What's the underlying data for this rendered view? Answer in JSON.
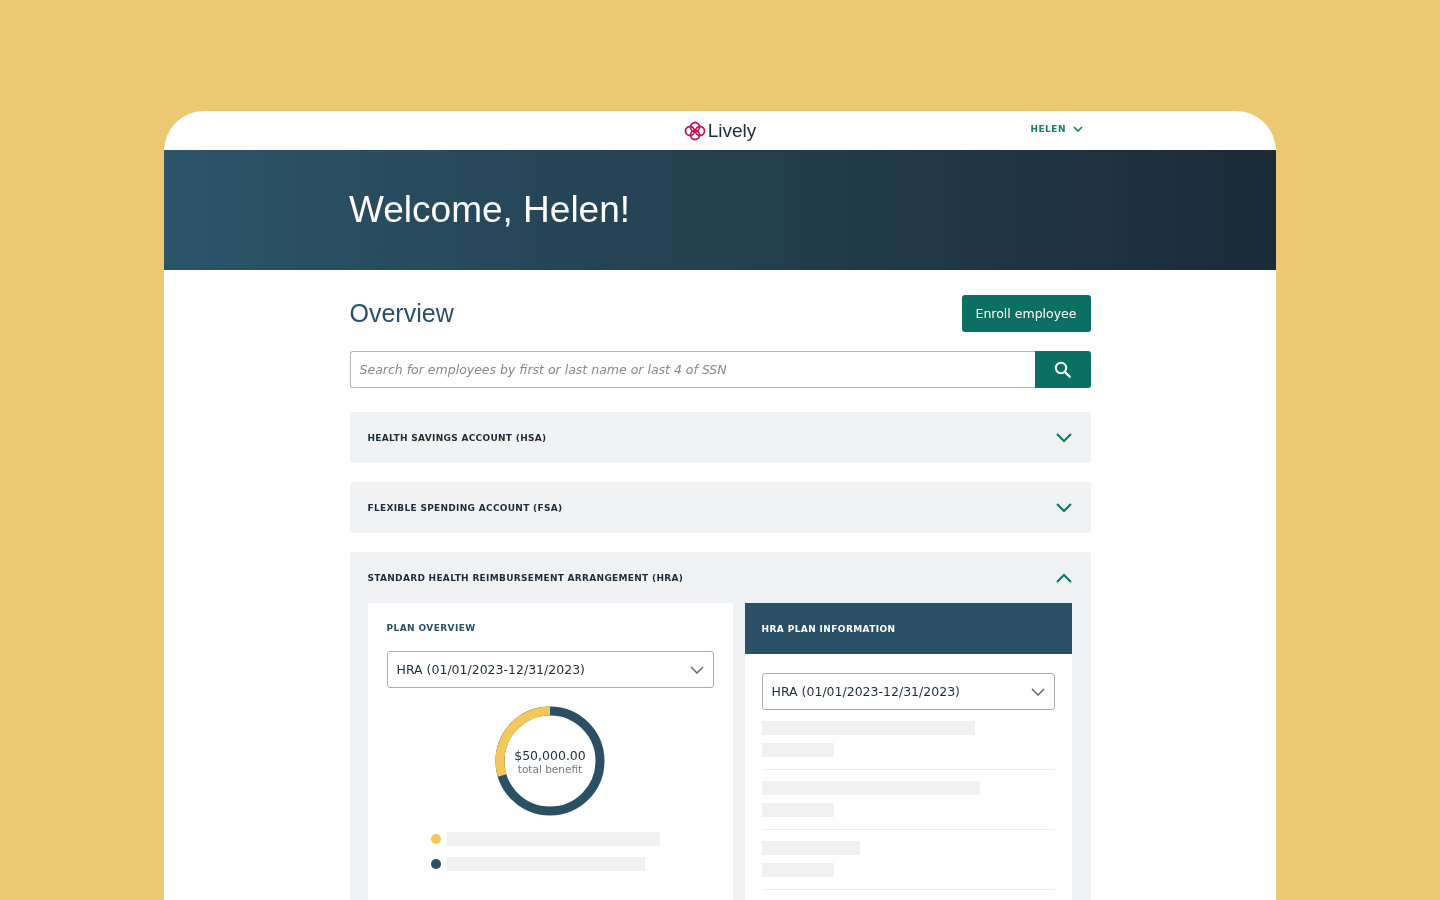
{
  "header": {
    "logo": "Lively",
    "user_menu": "HELEN"
  },
  "banner": {
    "title": "Welcome, Helen!"
  },
  "overview": {
    "title": "Overview",
    "enroll_button": "Enroll employee",
    "search": {
      "placeholder": "Search for employees by first or last name or last 4 of SSN"
    }
  },
  "accounts": [
    {
      "title": "HEALTH SAVINGS ACCOUNT (HSA)",
      "expanded": false
    },
    {
      "title": "FLEXIBLE SPENDING ACCOUNT (FSA)",
      "expanded": false
    },
    {
      "title": "STANDARD HEALTH REIMBURSEMENT ARRANGEMENT (HRA)",
      "expanded": true
    }
  ],
  "plan_overview": {
    "title": "PLAN OVERVIEW",
    "plan_select": "HRA (01/01/2023-12/31/2023)",
    "donut_amount": "$50,000.00",
    "donut_caption": "total benefit",
    "legend": [
      {
        "color": "#f3c75a"
      },
      {
        "color": "#2b5066"
      }
    ]
  },
  "plan_information": {
    "title": "HRA PLAN INFORMATION",
    "plan_select": "HRA (01/01/2023-12/31/2023)"
  }
}
